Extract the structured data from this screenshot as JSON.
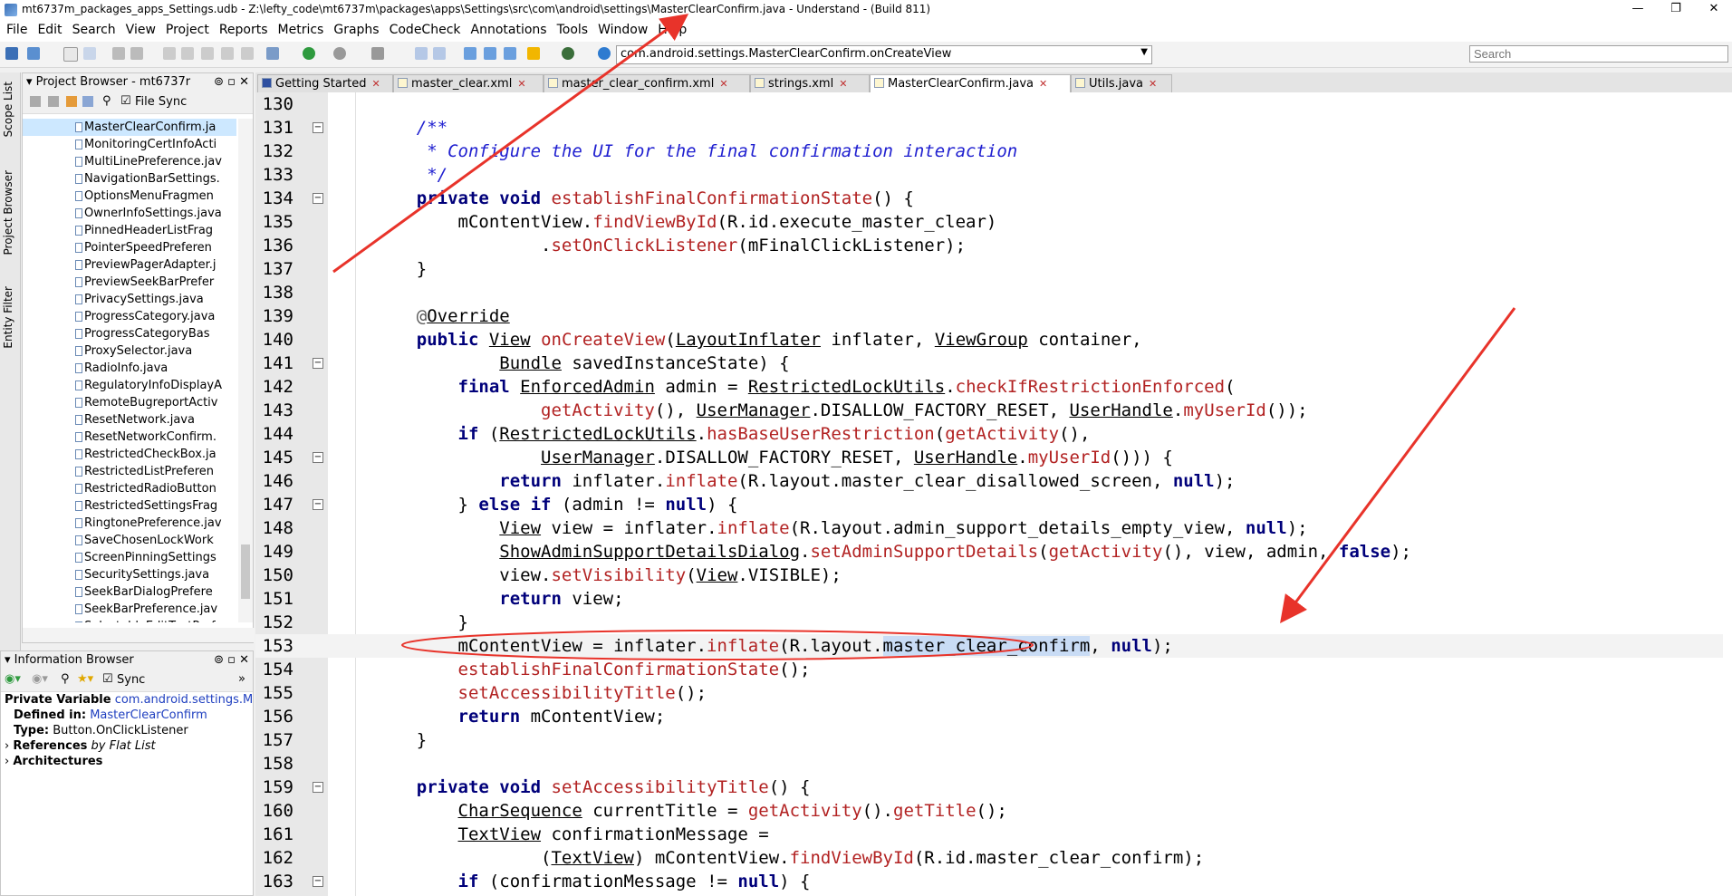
{
  "window": {
    "title": "mt6737m_packages_apps_Settings.udb - Z:\\lefty_code\\mt6737m\\packages\\apps\\Settings\\src\\com\\android\\settings\\MasterClearConfirm.java - Understand - (Build 811)",
    "minimize": "—",
    "maximize": "❐",
    "close": "✕"
  },
  "menu": [
    "File",
    "Edit",
    "Search",
    "View",
    "Project",
    "Reports",
    "Metrics",
    "Graphs",
    "CodeCheck",
    "Annotations",
    "Tools",
    "Window",
    "Help"
  ],
  "toolbar": {
    "scope_value": "com.android.settings.MasterClearConfirm.onCreateView",
    "search_placeholder": "Search"
  },
  "side_tabs": [
    "Scope List",
    "Project Browser",
    "Entity Filter"
  ],
  "project_browser": {
    "title": "Project Browser - mt6737r",
    "file_sync_label": "File Sync",
    "files": [
      "MasterClearConfirm.ja",
      "MonitoringCertInfoActi",
      "MultiLinePreference.jav",
      "NavigationBarSettings.",
      "OptionsMenuFragmen",
      "OwnerInfoSettings.java",
      "PinnedHeaderListFrag",
      "PointerSpeedPreferen",
      "PreviewPagerAdapter.j",
      "PreviewSeekBarPrefer",
      "PrivacySettings.java",
      "ProgressCategory.java",
      "ProgressCategoryBas",
      "ProxySelector.java",
      "RadioInfo.java",
      "RegulatoryInfoDisplayA",
      "RemoteBugreportActiv",
      "ResetNetwork.java",
      "ResetNetworkConfirm.",
      "RestrictedCheckBox.ja",
      "RestrictedListPreferen",
      "RestrictedRadioButton",
      "RestrictedSettingsFrag",
      "RingtonePreference.jav",
      "SaveChosenLockWork",
      "ScreenPinningSettings",
      "SecuritySettings.java",
      "SeekBarDialogPrefere",
      "SeekBarPreference.jav",
      "SelectableEditTextPref"
    ]
  },
  "info_browser": {
    "title": "Information Browser",
    "sync_label": "Sync",
    "kind_label": "Private Variable",
    "entity": "com.android.settings.M",
    "defined_in_label": "Defined in:",
    "defined_in_value": "MasterClearConfirm",
    "type_label": "Type:",
    "type_value": "Button.OnClickListener",
    "references_label": "References",
    "references_by": "by Flat List",
    "architectures_label": "Architectures"
  },
  "editor_tabs": [
    {
      "label": "Getting Started",
      "active": false
    },
    {
      "label": "master_clear.xml",
      "active": false
    },
    {
      "label": "master_clear_confirm.xml",
      "active": false
    },
    {
      "label": "strings.xml",
      "active": false
    },
    {
      "label": "MasterClearConfirm.java",
      "active": true
    },
    {
      "label": "Utils.java",
      "active": false
    }
  ],
  "code": {
    "lines": [
      "130",
      "131",
      "132",
      "133",
      "134",
      "135",
      "136",
      "137",
      "138",
      "139",
      "140",
      "141",
      "142",
      "143",
      "144",
      "145",
      "146",
      "147",
      "148",
      "149",
      "150",
      "151",
      "152",
      "153",
      "154",
      "155",
      "156",
      "157",
      "158",
      "159",
      "160",
      "161",
      "162",
      "163"
    ],
    "current_line": "153"
  },
  "colors": {
    "annotation": "#e8332a",
    "highlight": "#c9dcf5",
    "keyword": "#00007a",
    "method": "#b22222",
    "comment": "#2020d0"
  }
}
